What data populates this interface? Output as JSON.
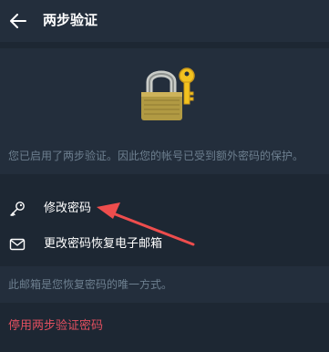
{
  "header": {
    "title": "两步验证",
    "back_icon": "arrow-left-icon"
  },
  "hero": {
    "illustration": "padlock-with-key",
    "info_text": "您已启用了两步验证。因此您的帐号已受到额外密码的保护。"
  },
  "menu": {
    "items": [
      {
        "label": "修改密码",
        "icon": "key-icon"
      },
      {
        "label": "更改密码恢复电子邮箱",
        "icon": "envelope-icon"
      }
    ]
  },
  "note": {
    "text": "此邮箱是您恢复密码的唯一方式。"
  },
  "disable": {
    "label": "停用两步验证密码"
  },
  "colors": {
    "background": "#1d2733",
    "panel": "#232e3c",
    "text_primary": "#ffffff",
    "text_secondary": "#6d7f8f",
    "danger": "#e04f5f",
    "annotation_arrow": "#ee4d4d"
  }
}
